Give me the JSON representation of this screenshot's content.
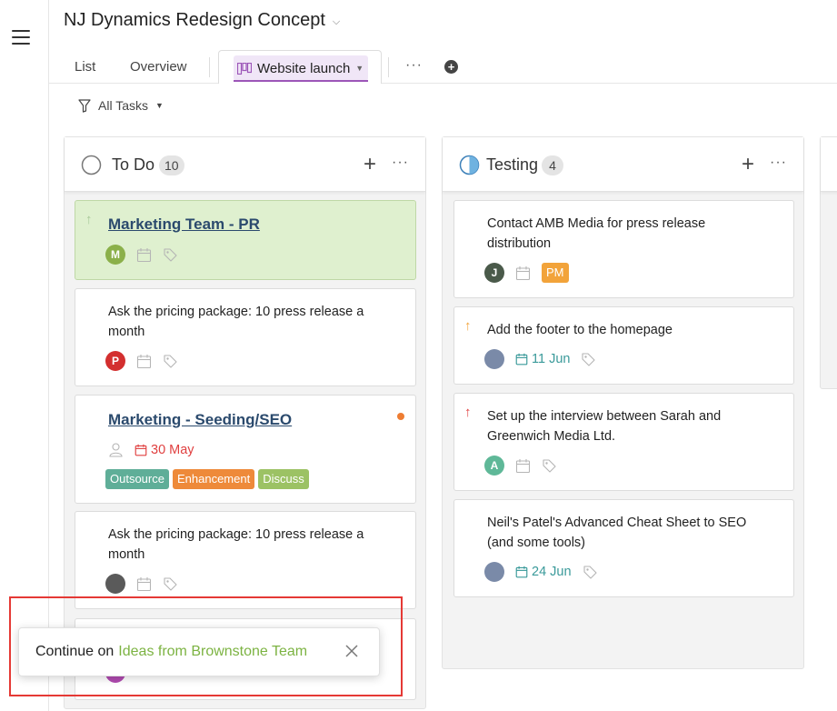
{
  "project": {
    "title": "NJ Dynamics Redesign Concept"
  },
  "tabs": {
    "list": "List",
    "overview": "Overview",
    "active": "Website launch",
    "more": "···",
    "add": "+"
  },
  "filter": {
    "label": "All Tasks"
  },
  "columns": [
    {
      "title": "To Do",
      "count": "10",
      "cards": [
        {
          "title": "Marketing Team - PR",
          "avatar": "M"
        },
        {
          "title": "Ask the pricing package: 10 press release a month",
          "avatar": "P"
        },
        {
          "title": "Marketing - Seeding/SEO",
          "due": "30 May",
          "tags": [
            "Outsource",
            "Enhancement",
            "Discuss"
          ]
        },
        {
          "title": "Ask the pricing package: 10 press release a month"
        }
      ]
    },
    {
      "title": "Testing",
      "count": "4",
      "cards": [
        {
          "title": "Contact AMB Media for press release distribution",
          "avatar": "J",
          "tag": "PM"
        },
        {
          "title": "Add the footer to the homepage",
          "due": "11 Jun"
        },
        {
          "title": "Set up the interview between Sarah and Greenwich Media Ltd.",
          "avatar": "A"
        },
        {
          "title": "Neil's Patel's Advanced Cheat Sheet to SEO (and some tools)",
          "due": "24 Jun"
        }
      ]
    }
  ],
  "toast": {
    "prefix": "Continue on",
    "link": "Ideas from Brownstone Team"
  },
  "colors": {
    "accent_purple": "#9c56b8",
    "link_green": "#7cb342",
    "due_red": "#e04040",
    "due_teal": "#3a9a9a",
    "tag_outsource": "#5fae98",
    "tag_enhancement": "#ee8a3a",
    "tag_discuss": "#9cc264",
    "tag_pm": "#f2a33a",
    "highlight_red": "#e53935"
  }
}
